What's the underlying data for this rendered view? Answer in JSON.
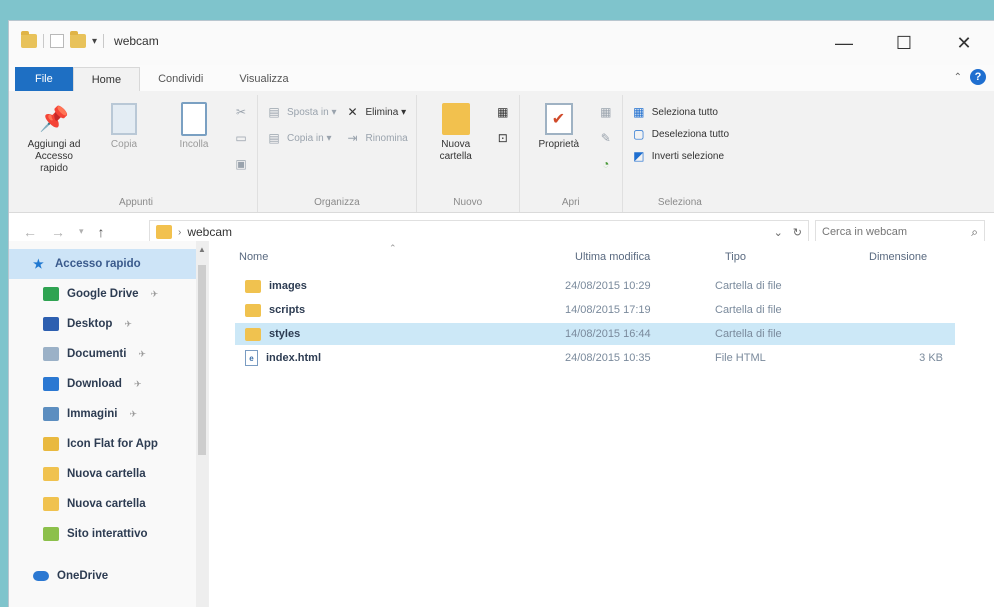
{
  "window": {
    "title": "webcam",
    "qa_dropdown": "▾",
    "minimize": "—",
    "maximize": "☐",
    "close": "✕"
  },
  "tabs": [
    "File",
    "Home",
    "Condividi",
    "Visualizza"
  ],
  "help": "?",
  "collapse": "⌃",
  "ribbon": {
    "appunti": {
      "label": "Appunti",
      "pin": "Aggiungi ad Accesso rapido",
      "copia": "Copia",
      "incolla": "Incolla"
    },
    "organizza": {
      "label": "Organizza",
      "sposta": "Sposta in ▾",
      "copia_in": "Copia in ▾",
      "elimina": "Elimina ▾",
      "rinomina": "Rinomina"
    },
    "nuovo": {
      "label": "Nuovo",
      "nuova_cartella": "Nuova cartella"
    },
    "apri": {
      "label": "Apri",
      "proprieta": "Proprietà"
    },
    "seleziona": {
      "label": "Seleziona",
      "tutto": "Seleziona tutto",
      "nessuna": "Deseleziona tutto",
      "inverti": "Inverti selezione"
    }
  },
  "address": {
    "path": "webcam",
    "search_placeholder": "Cerca in webcam"
  },
  "nav_pane": {
    "quick_access": "Accesso rapido",
    "items": [
      {
        "label": "Google Drive",
        "pinned": true,
        "color": "#2fa352"
      },
      {
        "label": "Desktop",
        "pinned": true,
        "color": "#2d5fb0"
      },
      {
        "label": "Documenti",
        "pinned": true,
        "color": "#9bb1c7"
      },
      {
        "label": "Download",
        "pinned": true,
        "color": "#2b78d2"
      },
      {
        "label": "Immagini",
        "pinned": true,
        "color": "#5c8ec0"
      },
      {
        "label": "Icon Flat for App",
        "pinned": false,
        "color": "#e9b93f"
      },
      {
        "label": "Nuova cartella",
        "pinned": false,
        "color": "#f0c24f"
      },
      {
        "label": "Nuova cartella",
        "pinned": false,
        "color": "#f0c24f"
      },
      {
        "label": "Sito interattivo",
        "pinned": false,
        "color": "#8cc04b"
      }
    ],
    "onedrive": "OneDrive",
    "pin_glyph": "✈"
  },
  "columns": {
    "name": "Nome",
    "modified": "Ultima modifica",
    "type": "Tipo",
    "size": "Dimensione"
  },
  "files": [
    {
      "name": "images",
      "modified": "24/08/2015 10:29",
      "type": "Cartella di file",
      "size": "",
      "kind": "folder"
    },
    {
      "name": "scripts",
      "modified": "14/08/2015 17:19",
      "type": "Cartella di file",
      "size": "",
      "kind": "folder"
    },
    {
      "name": "styles",
      "modified": "14/08/2015 16:44",
      "type": "Cartella di file",
      "size": "",
      "kind": "folder",
      "selected": true
    },
    {
      "name": "index.html",
      "modified": "24/08/2015 10:35",
      "type": "File HTML",
      "size": "3 KB",
      "kind": "html"
    }
  ],
  "colors": {
    "file_tab": "#1e6fc3",
    "selection": "#cce8f7",
    "folder": "#f0c24f",
    "background": "#7fc4cc"
  }
}
